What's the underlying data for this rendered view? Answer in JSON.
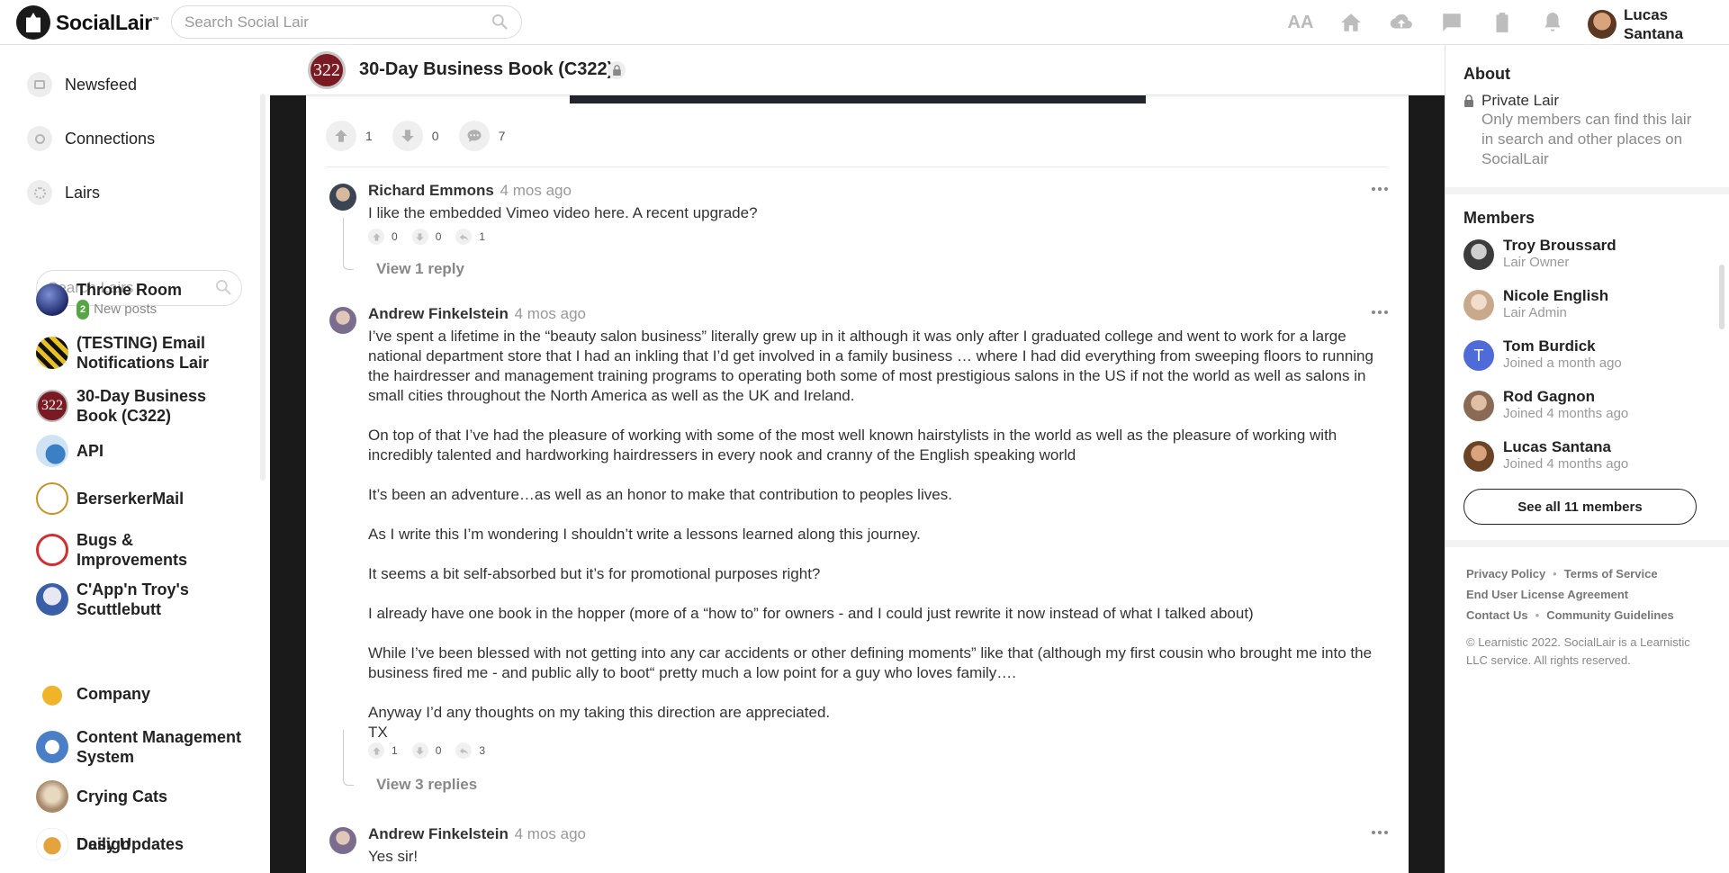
{
  "app": {
    "name": "SocialLair",
    "trademark": "™"
  },
  "search": {
    "placeholder": "Search Social Lair"
  },
  "top_icons": [
    "text-size-icon",
    "home-icon",
    "cloud-upload-icon",
    "messages-icon",
    "clipboard-icon",
    "bell-icon"
  ],
  "user": {
    "name": "Lucas Santana"
  },
  "nav": [
    {
      "label": "Newsfeed",
      "icon": "newsfeed-icon"
    },
    {
      "label": "Connections",
      "icon": "connections-icon"
    },
    {
      "label": "Lairs",
      "icon": "lairs-icon"
    }
  ],
  "lair_search": {
    "placeholder": "Search Lairs"
  },
  "lairs": [
    {
      "name": "Throne Room",
      "badge": "2",
      "sub": "New posts",
      "color": "#2b3a8a"
    },
    {
      "name": "(TESTING) Email Notifications Lair",
      "color": "#b8281e"
    },
    {
      "name": "30-Day Business Book (C322)",
      "icon_text": "322",
      "color": "#7a1a22"
    },
    {
      "name": "API",
      "color": "#3b7fc4"
    },
    {
      "name": "BerserkerMail",
      "color": "#c8922a"
    },
    {
      "name": "Bugs & Improvements",
      "color": "#d32f2f"
    },
    {
      "name": "C'App'n Troy's Scuttlebutt",
      "color": "#3a5fa8"
    },
    {
      "name": "Company",
      "color": "#f0b429"
    },
    {
      "name": "Content Management System",
      "color": "#4a7fc8"
    },
    {
      "name": "Crying Cats",
      "color": "#a88a6a"
    },
    {
      "name": "Daily Updates",
      "color": "#2a6fa8"
    },
    {
      "name": "Design",
      "color": "#e6a23c"
    }
  ],
  "lair_header": {
    "icon_text": "322",
    "title": "30-Day Business Book (C322)"
  },
  "post_actions": {
    "upvotes": "1",
    "downvotes": "0",
    "comments": "7"
  },
  "comments": [
    {
      "author": "Richard Emmons",
      "time": "4 mos ago",
      "paragraphs": [
        "I like the embedded Vimeo video here. A recent upgrade?"
      ],
      "up": "0",
      "down": "0",
      "replies": "1",
      "view_replies": "View 1 reply",
      "avatar_color": "#4b5563"
    },
    {
      "author": "Andrew Finkelstein",
      "time": "4 mos ago",
      "paragraphs": [
        "I’ve spent a lifetime in the “beauty salon business” literally grew up in it although it was only after I graduated college and went to work for a large national department store that I had an inkling that I’d get involved in a family business … where I had did everything from sweeping floors to running the hairdresser and management training programs to operating both some of most prestigious salons in the US if not the world as well as salons in small cities throughout the North America as well as the UK and Ireland.",
        "On top of that I’ve had the pleasure of working with some of the most well known hairstylists in the world as well as the pleasure of working with incredibly talented and hardworking hairdressers in every nook and cranny of the English speaking world",
        "It’s been an adventure…as well as an honor to make that contribution to peoples lives.",
        "As I write this I’m wondering I shouldn’t write a lessons learned along this journey.",
        "It seems a bit self-absorbed but it’s for promotional purposes right?",
        "I already have one book in the hopper (more of a “how to” for owners - and I could just rewrite it now instead of what I talked about)",
        "While I’ve been blessed with not getting into any car accidents or other defining moments” like that (although my first cousin who brought me into the business fired me - and public ally to boot“ pretty much a low point for a guy who loves family….",
        "Anyway I’d any thoughts on my taking this direction are appreciated.\nTX"
      ],
      "up": "1",
      "down": "0",
      "replies": "3",
      "view_replies": "View 3 replies",
      "avatar_color": "#7b6d8d"
    },
    {
      "author": "Andrew Finkelstein",
      "time": "4 mos ago",
      "paragraphs": [
        "Yes sir!"
      ],
      "avatar_color": "#7b6d8d"
    }
  ],
  "about": {
    "title": "About",
    "privacy_title": "Private Lair",
    "privacy_desc": "Only members can find this lair in search and other places on SocialLair"
  },
  "members": {
    "title": "Members",
    "list": [
      {
        "name": "Troy Broussard",
        "role": "Lair Owner",
        "color": "#3c3c3c"
      },
      {
        "name": "Nicole English",
        "role": "Lair Admin",
        "color": "#c9a98c"
      },
      {
        "name": "Tom Burdick",
        "role": "Joined a month ago",
        "initial": "T",
        "color": "#4f6bd8"
      },
      {
        "name": "Rod Gagnon",
        "role": "Joined 4 months ago",
        "color": "#8a6a55"
      },
      {
        "name": "Lucas Santana",
        "role": "Joined 4 months ago",
        "color": "#6b4428"
      }
    ],
    "see_all": "See all 11 members"
  },
  "footer": {
    "privacy": "Privacy Policy",
    "terms": "Terms of Service",
    "eula": "End User License Agreement",
    "contact": "Contact Us",
    "guidelines": "Community Guidelines",
    "copyright": "© Learnistic 2022. SocialLair is a Learnistic LLC service. All rights reserved."
  }
}
